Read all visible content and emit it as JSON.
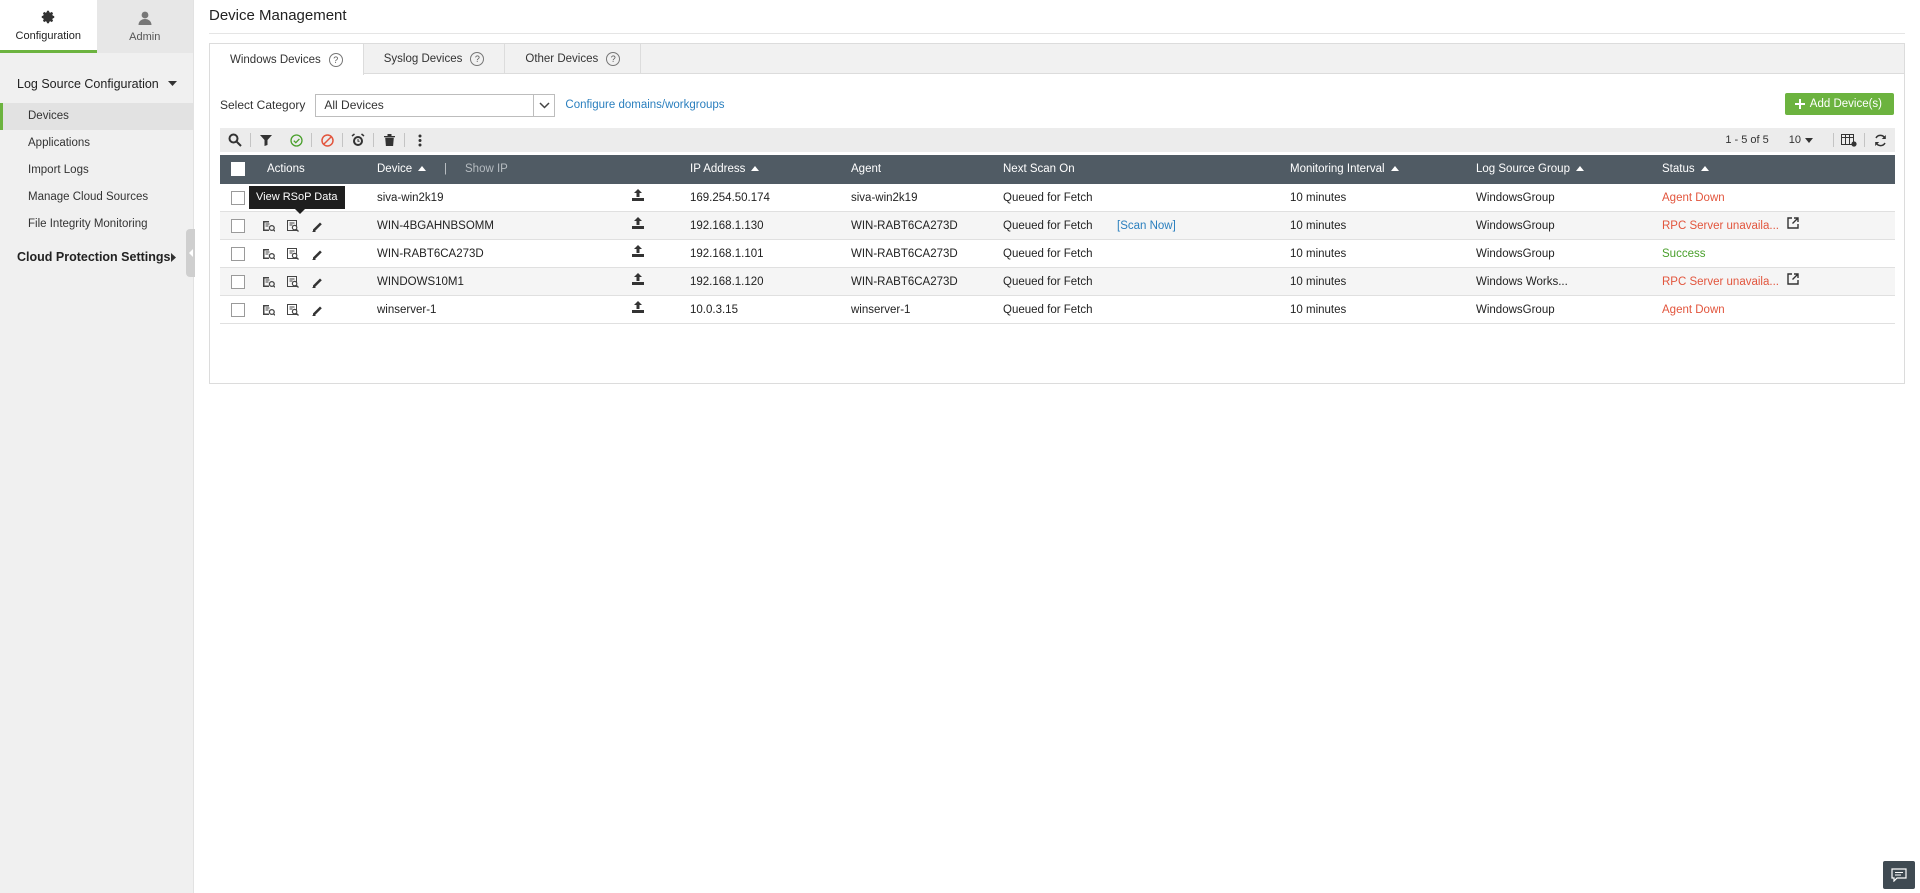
{
  "sidebar": {
    "tabs": [
      {
        "label": "Configuration",
        "icon": "gear-icon",
        "active": true
      },
      {
        "label": "Admin",
        "icon": "user-icon",
        "active": false
      }
    ],
    "section_log_source": "Log Source Configuration",
    "items": [
      {
        "label": "Devices",
        "active": true
      },
      {
        "label": "Applications"
      },
      {
        "label": "Import Logs"
      },
      {
        "label": "Manage Cloud Sources"
      },
      {
        "label": "File Integrity Monitoring"
      }
    ],
    "section_cloud": "Cloud Protection Settings"
  },
  "page": {
    "title": "Device Management"
  },
  "tabs": [
    {
      "label": "Windows Devices",
      "active": true
    },
    {
      "label": "Syslog Devices"
    },
    {
      "label": "Other Devices"
    }
  ],
  "category": {
    "label": "Select Category",
    "value": "All Devices",
    "configure_link": "Configure domains/workgroups",
    "add_button": "Add Device(s)"
  },
  "toolbar": {
    "count": "1 - 5 of 5",
    "per_page": "10"
  },
  "table": {
    "headers": {
      "actions": "Actions",
      "device": "Device",
      "show_ip": "Show IP",
      "ip": "IP Address",
      "agent": "Agent",
      "next_scan": "Next Scan On",
      "interval": "Monitoring Interval",
      "group": "Log Source Group",
      "status": "Status"
    },
    "rows": [
      {
        "device": "siva-win2k19",
        "ip": "169.254.50.174",
        "agent": "siva-win2k19",
        "next_scan": "Queued for Fetch",
        "scan_now": "",
        "interval": "10 minutes",
        "group": "WindowsGroup",
        "status": "Agent Down",
        "status_color": "#e2553d",
        "status_link": false
      },
      {
        "device": "WIN-4BGAHNBSOMM",
        "ip": "192.168.1.130",
        "agent": "WIN-RABT6CA273D",
        "next_scan": "Queued for Fetch",
        "scan_now": "[Scan Now]",
        "interval": "10 minutes",
        "group": "WindowsGroup",
        "status": "RPC Server unavaila...",
        "status_color": "#e2553d",
        "status_link": true
      },
      {
        "device": "WIN-RABT6CA273D",
        "ip": "192.168.1.101",
        "agent": "WIN-RABT6CA273D",
        "next_scan": "Queued for Fetch",
        "scan_now": "",
        "interval": "10 minutes",
        "group": "WindowsGroup",
        "status": "Success",
        "status_color": "#4aa02c",
        "status_link": false
      },
      {
        "device": "WINDOWS10M1",
        "ip": "192.168.1.120",
        "agent": "WIN-RABT6CA273D",
        "next_scan": "Queued for Fetch",
        "scan_now": "",
        "interval": "10 minutes",
        "group": "Windows Works...",
        "status": "RPC Server unavaila...",
        "status_color": "#e2553d",
        "status_link": true
      },
      {
        "device": "winserver-1",
        "ip": "10.0.3.15",
        "agent": "winserver-1",
        "next_scan": "Queued for Fetch",
        "scan_now": "",
        "interval": "10 minutes",
        "group": "WindowsGroup",
        "status": "Agent Down",
        "status_color": "#e2553d",
        "status_link": false
      }
    ]
  },
  "tooltip": {
    "text": "View RSoP Data"
  },
  "colors": {
    "accent": "#6cb33f",
    "header": "#505b64",
    "link": "#2a7fbe",
    "error": "#e2553d",
    "success": "#4aa02c"
  }
}
